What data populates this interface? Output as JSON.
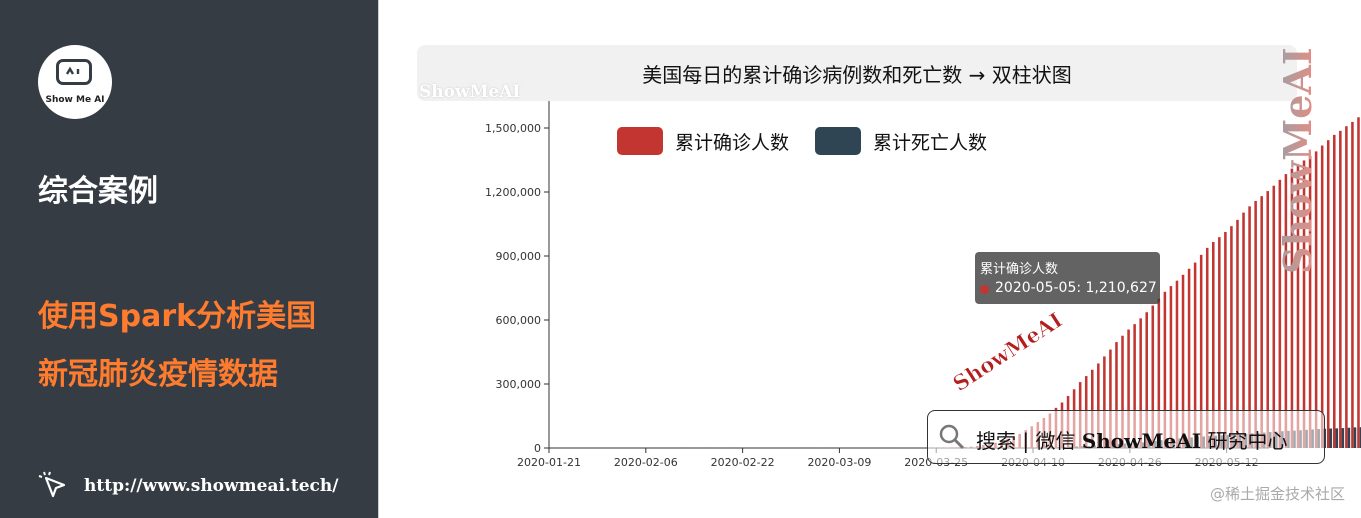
{
  "sidebar": {
    "logo_text": "Show Me AI",
    "section_title": "综合案例",
    "topic_line1": "使用Spark分析美国",
    "topic_line2": "新冠肺炎疫情数据",
    "url": "http://www.showmeai.tech/"
  },
  "watermarks": {
    "small": "ShowMeAI",
    "diagonal": "ShowMeAI",
    "vertical": "ShowMeAI",
    "search_prefix": "搜索 | 微信",
    "search_brand": "ShowMeAI",
    "search_suffix": "研究中心",
    "footer": "@稀土掘金技术社区"
  },
  "tooltip": {
    "series": "累计确诊人数",
    "text": "2020-05-05: 1,210,627"
  },
  "colors": {
    "sidebar_bg": "#353c44",
    "accent_orange": "#ff7b2e",
    "confirmed": "#c23531",
    "deaths": "#2f4554"
  },
  "chart_data": {
    "type": "bar",
    "title": "美国每日的累计确诊病例数和死亡数 → 双柱状图",
    "x_start": "2020-01-21",
    "x_end": "2020-05-19",
    "x_ticks": [
      "2020-01-21",
      "2020-02-06",
      "2020-02-22",
      "2020-03-09",
      "2020-03-25",
      "2020-04-10",
      "2020-04-26",
      "2020-05-12"
    ],
    "y_ticks": [
      "0",
      "300,000",
      "600,000",
      "900,000",
      "1,200,000",
      "1,500,000"
    ],
    "ylim": [
      0,
      1650000
    ],
    "legend_position": "top-left",
    "grid": false,
    "series": [
      {
        "name": "累计确诊人数",
        "color": "#c23531",
        "values": [
          1,
          1,
          2,
          2,
          5,
          5,
          5,
          5,
          5,
          6,
          7,
          8,
          11,
          11,
          11,
          12,
          12,
          12,
          12,
          12,
          13,
          13,
          14,
          14,
          14,
          14,
          14,
          14,
          14,
          14,
          15,
          15,
          15,
          15,
          15,
          15,
          15,
          16,
          16,
          16,
          16,
          16,
          16,
          16,
          16,
          16,
          16,
          16,
          16,
          17,
          35,
          35,
          53,
          60,
          62,
          70,
          88,
          129,
          241,
          338,
          445,
          572,
          717,
          1004,
          1323,
          1832,
          2291,
          2995,
          3539,
          4663,
          6438,
          9367,
          13787,
          19383,
          24207,
          33566,
          43734,
          53740,
          65778,
          83836,
          101657,
          121478,
          140886,
          161807,
          188172,
          213242,
          243622,
          275367,
          308853,
          337072,
          366667,
          396223,
          429052,
          461437,
          496535,
          526396,
          555313,
          580619,
          607670,
          636350,
          667592,
          699706,
          732197,
          758809,
          784326,
          811865,
          840351,
          869170,
          905358,
          938154,
          965785,
          988197,
          1012582,
          1039909,
          1069424,
          1103461,
          1132539,
          1158040,
          1180375,
          1204351,
          1229331,
          1257023,
          1283929,
          1309550,
          1329260,
          1347881,
          1369376,
          1390406,
          1417774,
          1442824,
          1467820,
          1486757,
          1508308,
          1528568,
          1550294
        ]
      },
      {
        "name": "累计死亡人数",
        "color": "#2f4554",
        "values": [
          0,
          0,
          0,
          0,
          0,
          0,
          0,
          0,
          0,
          0,
          0,
          0,
          0,
          0,
          0,
          0,
          0,
          0,
          0,
          0,
          0,
          0,
          0,
          0,
          0,
          0,
          0,
          0,
          0,
          0,
          0,
          0,
          0,
          0,
          0,
          0,
          0,
          0,
          0,
          0,
          0,
          0,
          0,
          0,
          0,
          0,
          0,
          0,
          0,
          0,
          0,
          0,
          0,
          0,
          0,
          0,
          0,
          0,
          0,
          0,
          0,
          0,
          0,
          0,
          0,
          0,
          0,
          0,
          0,
          0,
          0,
          0,
          0,
          0,
          0,
          0,
          0,
          0,
          0,
          1000,
          1500,
          2000,
          2500,
          3100,
          3900,
          4800,
          5900,
          7000,
          8400,
          9600,
          11000,
          12800,
          14700,
          16600,
          18700,
          20600,
          22100,
          23600,
          26000,
          28300,
          32900,
          36800,
          40600,
          42500,
          44800,
          47000,
          49700,
          52200,
          54300,
          56000,
          57800,
          59800,
          62000,
          64300,
          66200,
          67700,
          69000,
          70500,
          72600,
          74800,
          76800,
          78700,
          80400,
          81500,
          83000,
          85000,
          87000,
          88700,
          90200,
          91400,
          92100,
          93400,
          95000,
          96600,
          97600
        ]
      }
    ]
  }
}
